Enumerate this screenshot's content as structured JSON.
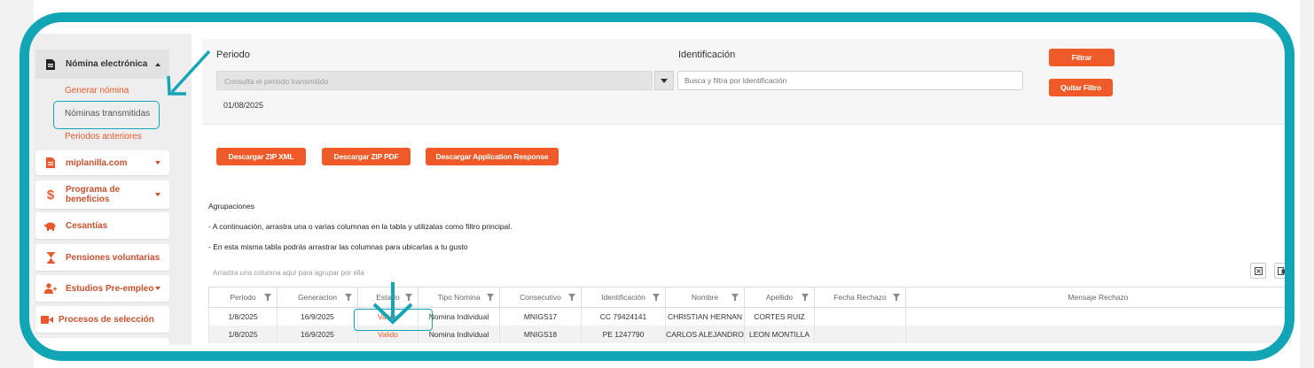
{
  "sidebar": {
    "active": {
      "icon": "document-icon",
      "label": "Nómina electrónica"
    },
    "subitems": [
      {
        "label": "Generar nómina",
        "selected": false
      },
      {
        "label": "Nóminas transmitidas",
        "selected": true
      },
      {
        "label": "Periodos anteriores",
        "selected": false
      }
    ],
    "items": [
      {
        "icon": "file-icon",
        "label": "miplanilla.com",
        "caret": true
      },
      {
        "icon": "dollar-icon",
        "label": "Programa de beneficios",
        "caret": true
      },
      {
        "icon": "piggy-bank-icon",
        "label": "Cesantías",
        "caret": false
      },
      {
        "icon": "hourglass-icon",
        "label": "Pensiones voluntarias",
        "caret": false
      },
      {
        "icon": "user-plus-icon",
        "label": "Estudios Pre-empleo",
        "caret": true
      },
      {
        "icon": "video-camera-icon",
        "label": "Procesos de selección",
        "caret": false
      }
    ]
  },
  "filters": {
    "periodo_label": "Periodo",
    "periodo_placeholder": "Consulta el periodo transmitido",
    "periodo_value": "01/08/2025",
    "identificacion_label": "Identificación",
    "identificacion_placeholder": "Busca y filtra por Identificación",
    "filtrar_label": "Filtrar",
    "quitar_label": "Quitar Filtro"
  },
  "downloads": {
    "zip_xml": "Descargar ZIP XML",
    "zip_pdf": "Descargar ZIP PDF",
    "app_response": "Descargar Application Response"
  },
  "agrupaciones": {
    "title": "Agrupaciones",
    "line1": "- A continuación, arrastra una o varias columnas en la tabla y utilizalas como filtro principal.",
    "line2": "- En esta misma tabla podrás arrastrar las columnas para ubicarlas a tu gusto",
    "drop_hint": "Arrastra una columna aquí para agrupar por ella"
  },
  "table": {
    "headers": [
      "Periodo",
      "Generacion",
      "Estado",
      "Tipo Nomina",
      "Consecutivo",
      "Identificación",
      "Nombre",
      "Apellido",
      "Fecha Rechazo",
      "Mensaje Rechazo"
    ],
    "rows": [
      [
        "1/8/2025",
        "16/9/2025",
        "Valido",
        "Nomina Individual",
        "MNIGS17",
        "CC 79424141",
        "CHRISTIAN HERNAN",
        "CORTES RUIZ",
        "",
        ""
      ],
      [
        "1/8/2025",
        "16/9/2025",
        "Valido",
        "Nomina Individual",
        "MNIGS18",
        "PE 1247790",
        "CARLOS ALEJANDRO",
        "LEON MONTILLA",
        "",
        ""
      ]
    ]
  },
  "colors": {
    "accent": "#f05a28",
    "highlight": "#12a5b5",
    "sidebar_text": "#c8502c"
  }
}
